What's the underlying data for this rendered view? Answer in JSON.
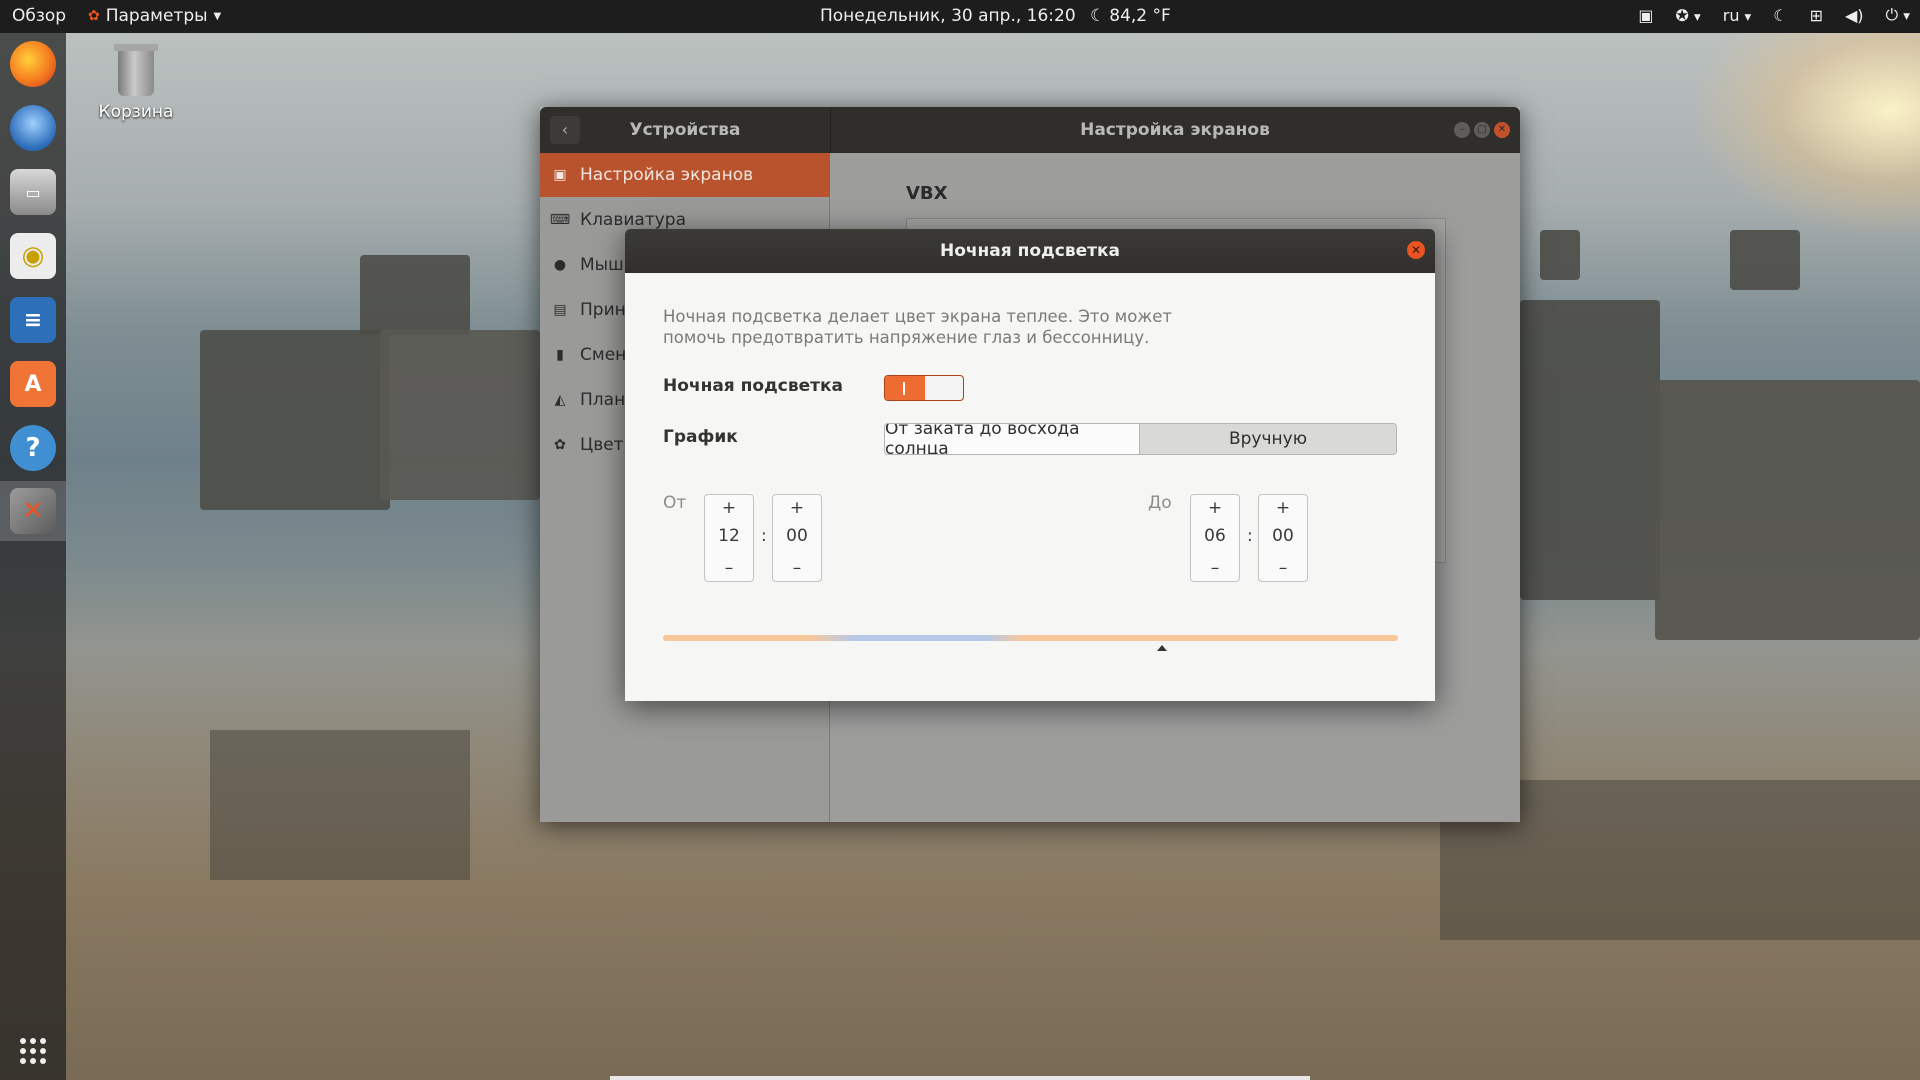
{
  "topbar": {
    "overview": "Обзор",
    "app_menu": "Параметры",
    "clock": "Понедельник, 30 апр., 16:20",
    "weather": "84,2 °F",
    "language": "ru",
    "icons": [
      "gamepad-icon",
      "accessibility-icon",
      "night-light-icon",
      "network-icon",
      "volume-icon",
      "power-icon"
    ]
  },
  "dock": {
    "apps": [
      "firefox",
      "thunderbird",
      "files",
      "rhythmbox",
      "libreoffice-writer",
      "ubuntu-software",
      "help",
      "settings"
    ],
    "active": "settings"
  },
  "desktop": {
    "trash_label": "Корзина"
  },
  "settings_window": {
    "sidebar_title": "Устройства",
    "main_title": "Настройка экранов",
    "sidebar_items": [
      {
        "label": "Настройка экранов",
        "icon": "display-icon",
        "active": true
      },
      {
        "label": "Клавиатура",
        "icon": "keyboard-icon"
      },
      {
        "label": "Мышь",
        "icon": "mouse-icon"
      },
      {
        "label": "Принт",
        "icon": "printer-icon"
      },
      {
        "label": "Смен",
        "icon": "removable-media-icon"
      },
      {
        "label": "План",
        "icon": "tablet-icon"
      },
      {
        "label": "Цвет",
        "icon": "color-icon"
      }
    ],
    "section_title": "VBX"
  },
  "dialog": {
    "title": "Ночная подсветка",
    "description": "Ночная подсветка делает цвет экрана теплее. Это может помочь предотвратить напряжение глаз и бессонницу.",
    "night_light_label": "Ночная подсветка",
    "night_light_enabled": true,
    "schedule_label": "График",
    "schedule_options": [
      "От заката до восхода солнца",
      "Вручную"
    ],
    "schedule_selected": "Вручную",
    "from_label": "От",
    "to_label": "До",
    "from_hours": "12",
    "from_minutes": "00",
    "to_hours": "06",
    "to_minutes": "00",
    "plus": "+",
    "minus": "–",
    "colon": ":",
    "accent_color": "#e95420"
  }
}
